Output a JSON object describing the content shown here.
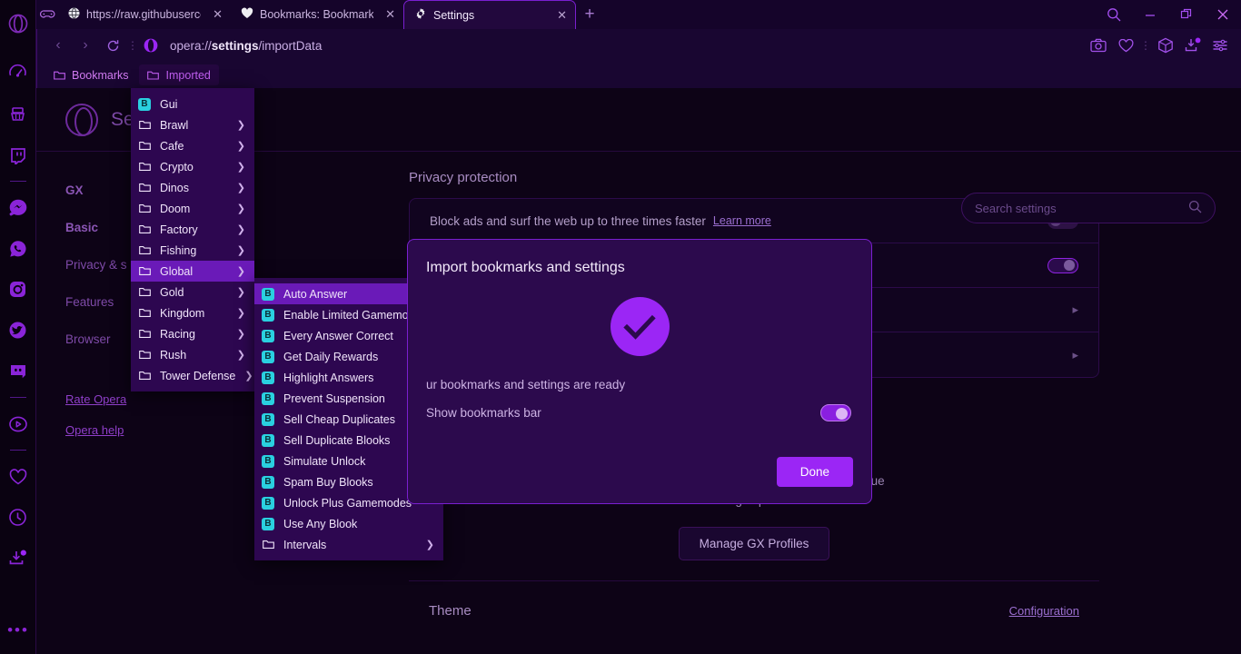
{
  "window": {
    "controls": {
      "search": "search-icon",
      "minimize": "minimize-icon",
      "restore": "restore-icon",
      "close": "close-icon"
    }
  },
  "tabs": {
    "gamepad_icon": "gamepad-icon",
    "new_tab_label": "+",
    "items": [
      {
        "label": "https://raw.githubuserconte",
        "icon": "globe-icon",
        "active": false
      },
      {
        "label": "Bookmarks: Bookmarks bar",
        "icon": "heart-icon",
        "active": false
      },
      {
        "label": "Settings",
        "icon": "gear-icon",
        "active": true
      }
    ]
  },
  "address_bar": {
    "url_prefix": "opera://",
    "url_bold": "settings",
    "url_suffix": "/importData",
    "back": "back-arrow-icon",
    "forward": "forward-arrow-icon",
    "reload": "reload-icon",
    "right_icons": [
      "camera-icon",
      "heart-icon",
      "dots-icon",
      "cube-icon",
      "download-icon",
      "easy-setup-icon"
    ]
  },
  "bookmarks_bar": {
    "items": [
      {
        "label": "Bookmarks",
        "open": false
      },
      {
        "label": "Imported",
        "open": true
      }
    ]
  },
  "bookmark_menu": {
    "items": [
      {
        "label": "Gui",
        "type": "bookmark",
        "submenu": false,
        "selected": false
      },
      {
        "label": "Brawl",
        "type": "folder",
        "submenu": true,
        "selected": false
      },
      {
        "label": "Cafe",
        "type": "folder",
        "submenu": true,
        "selected": false
      },
      {
        "label": "Crypto",
        "type": "folder",
        "submenu": true,
        "selected": false
      },
      {
        "label": "Dinos",
        "type": "folder",
        "submenu": true,
        "selected": false
      },
      {
        "label": "Doom",
        "type": "folder",
        "submenu": true,
        "selected": false
      },
      {
        "label": "Factory",
        "type": "folder",
        "submenu": true,
        "selected": false
      },
      {
        "label": "Fishing",
        "type": "folder",
        "submenu": true,
        "selected": false
      },
      {
        "label": "Global",
        "type": "folder",
        "submenu": true,
        "selected": true
      },
      {
        "label": "Gold",
        "type": "folder",
        "submenu": true,
        "selected": false
      },
      {
        "label": "Kingdom",
        "type": "folder",
        "submenu": true,
        "selected": false
      },
      {
        "label": "Racing",
        "type": "folder",
        "submenu": true,
        "selected": false
      },
      {
        "label": "Rush",
        "type": "folder",
        "submenu": true,
        "selected": false
      },
      {
        "label": "Tower Defense",
        "type": "folder",
        "submenu": true,
        "selected": false
      }
    ]
  },
  "bookmark_submenu": {
    "items": [
      {
        "label": "Auto Answer",
        "type": "bookmark",
        "submenu": false,
        "selected": true
      },
      {
        "label": "Enable Limited Gamemodes",
        "type": "bookmark",
        "submenu": false,
        "selected": false
      },
      {
        "label": "Every Answer Correct",
        "type": "bookmark",
        "submenu": false,
        "selected": false
      },
      {
        "label": "Get Daily Rewards",
        "type": "bookmark",
        "submenu": false,
        "selected": false
      },
      {
        "label": "Highlight Answers",
        "type": "bookmark",
        "submenu": false,
        "selected": false
      },
      {
        "label": "Prevent Suspension",
        "type": "bookmark",
        "submenu": false,
        "selected": false
      },
      {
        "label": "Sell Cheap Duplicates",
        "type": "bookmark",
        "submenu": false,
        "selected": false
      },
      {
        "label": "Sell Duplicate Blooks",
        "type": "bookmark",
        "submenu": false,
        "selected": false
      },
      {
        "label": "Simulate Unlock",
        "type": "bookmark",
        "submenu": false,
        "selected": false
      },
      {
        "label": "Spam Buy Blooks",
        "type": "bookmark",
        "submenu": false,
        "selected": false
      },
      {
        "label": "Unlock Plus Gamemodes",
        "type": "bookmark",
        "submenu": false,
        "selected": false
      },
      {
        "label": "Use Any Blook",
        "type": "bookmark",
        "submenu": false,
        "selected": false
      },
      {
        "label": "Intervals",
        "type": "folder",
        "submenu": true,
        "selected": false
      }
    ]
  },
  "settings_page": {
    "title": "Settings",
    "search_placeholder": "Search settings",
    "nav": [
      {
        "label": "GX",
        "bold": true
      },
      {
        "label": "Basic",
        "bold": true
      },
      {
        "label": "Privacy & s",
        "bold": false
      },
      {
        "label": "Features",
        "bold": false
      },
      {
        "label": "Browser",
        "bold": false
      }
    ],
    "links": [
      {
        "label": "Rate Opera"
      },
      {
        "label": "Opera help"
      }
    ],
    "privacy": {
      "section_title": "Privacy protection",
      "rows": [
        {
          "label": "Block ads and surf the web up to three times faster",
          "link": "Learn more",
          "control": "toggle-off"
        },
        {
          "label": "",
          "link": "",
          "control": "toggle-on"
        },
        {
          "label": "",
          "link": "",
          "control": "chevron"
        },
        {
          "label": "",
          "link": "",
          "control": "chevron"
        }
      ]
    },
    "gx_profiles": {
      "description_line1": "Setup different instances of GX to create unique",
      "description_line2": "browsing experiences.",
      "button": "Manage GX Profiles"
    },
    "theme": {
      "title": "Theme",
      "link": "Configuration"
    }
  },
  "import_dialog": {
    "title": "Import bookmarks and settings",
    "success_icon": "check-circle-icon",
    "ready_text": "ur bookmarks and settings are ready",
    "toggle_label": "Show bookmarks bar",
    "toggle_state": "on",
    "done_label": "Done"
  },
  "colors": {
    "accent": "#9b26f5",
    "menu_bg": "#2d0750",
    "menu_selected": "#6a1ab8",
    "bookmark_icon": "#2ad0e0",
    "page_bg": "#0d0316"
  },
  "sidebar_rail": {
    "icons": [
      "gx-corner-icon",
      "cleaner-icon",
      "twitch-icon",
      "divider",
      "messenger-icon",
      "whatsapp-icon",
      "instagram-icon",
      "twitter-icon",
      "discord-icon",
      "divider",
      "player-icon",
      "divider",
      "favorites-icon",
      "history-icon",
      "downloads-icon"
    ],
    "more": "more-icon"
  }
}
